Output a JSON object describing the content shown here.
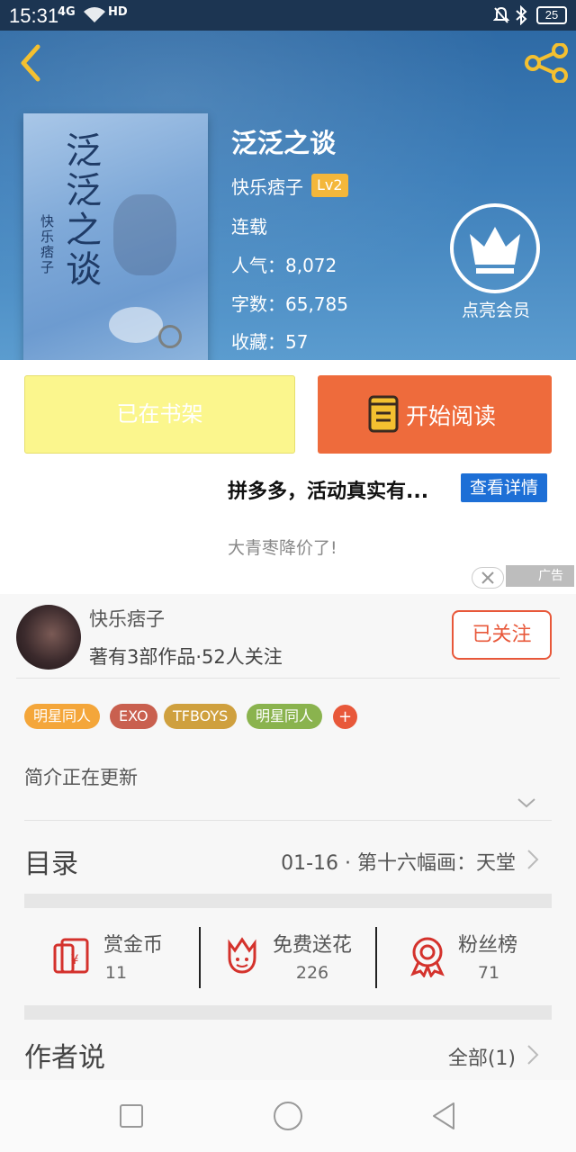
{
  "status_bar": {
    "time": "15:31",
    "signal": "4G",
    "hd": "HD",
    "battery": "25"
  },
  "book": {
    "title": "泛泛之谈",
    "author": "快乐痞子",
    "level": "Lv2",
    "status": "连载",
    "popularity": "人气：8,072",
    "word_count": "字数：65,785",
    "favorites": "收藏：57",
    "cover_title": "泛泛之谈",
    "cover_author": "快乐痞子"
  },
  "vip": {
    "label": "点亮会员"
  },
  "actions": {
    "shelf_label": "已在书架",
    "read_label": "开始阅读"
  },
  "ad": {
    "text": "拼多多，活动真实有...",
    "button": "查看详情",
    "subtext": "大青枣降价了!",
    "tag": "广告"
  },
  "author_row": {
    "name": "快乐痞子",
    "stats": "著有3部作品·52人关注",
    "follow_label": "已关注"
  },
  "tags": [
    {
      "label": "明星同人",
      "color": "#f4a63a"
    },
    {
      "label": "EXO",
      "color": "#c9604f"
    },
    {
      "label": "TFBOYS",
      "color": "#cfa03e"
    },
    {
      "label": "明星同人",
      "color": "#8ab34e"
    }
  ],
  "tag_more": "+",
  "intro": "简介正在更新",
  "toc": {
    "label": "目录",
    "latest": "01-16 · 第十六幅画：天堂"
  },
  "stats": [
    {
      "label": "赏金币",
      "value": "11",
      "icon": "red-envelope-icon"
    },
    {
      "label": "免费送花",
      "value": "226",
      "icon": "flower-icon"
    },
    {
      "label": "粉丝榜",
      "value": "71",
      "icon": "medal-icon"
    }
  ],
  "author_say": {
    "label": "作者说",
    "all": "全部(1)"
  },
  "colors": {
    "accent": "#ee6b3c",
    "shelf": "#fbf68d",
    "hero": "#3e7fba",
    "ad_button": "#1d6fd6"
  }
}
